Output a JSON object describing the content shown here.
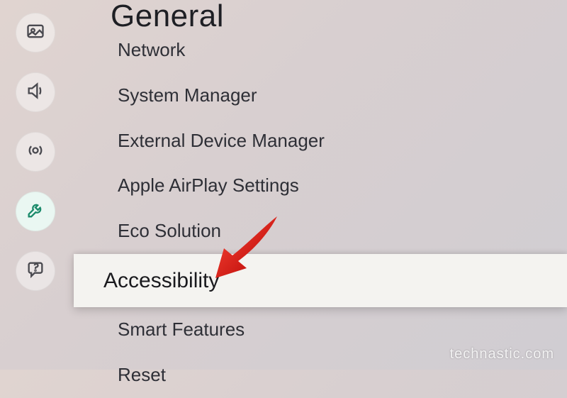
{
  "page": {
    "title": "General"
  },
  "sidebar": {
    "items": [
      {
        "name": "picture-icon"
      },
      {
        "name": "sound-icon"
      },
      {
        "name": "broadcast-icon"
      },
      {
        "name": "general-icon"
      },
      {
        "name": "support-icon"
      }
    ],
    "active": 3
  },
  "menu": {
    "items": [
      {
        "label": "Network",
        "partial": true
      },
      {
        "label": "System Manager"
      },
      {
        "label": "External Device Manager"
      },
      {
        "label": "Apple AirPlay Settings"
      },
      {
        "label": "Eco Solution"
      },
      {
        "label": "Accessibility",
        "selected": true
      },
      {
        "label": "Smart Features"
      },
      {
        "label": "Reset"
      }
    ]
  },
  "annotation": {
    "arrow_color": "#d52020"
  },
  "watermark": "technastic.com"
}
